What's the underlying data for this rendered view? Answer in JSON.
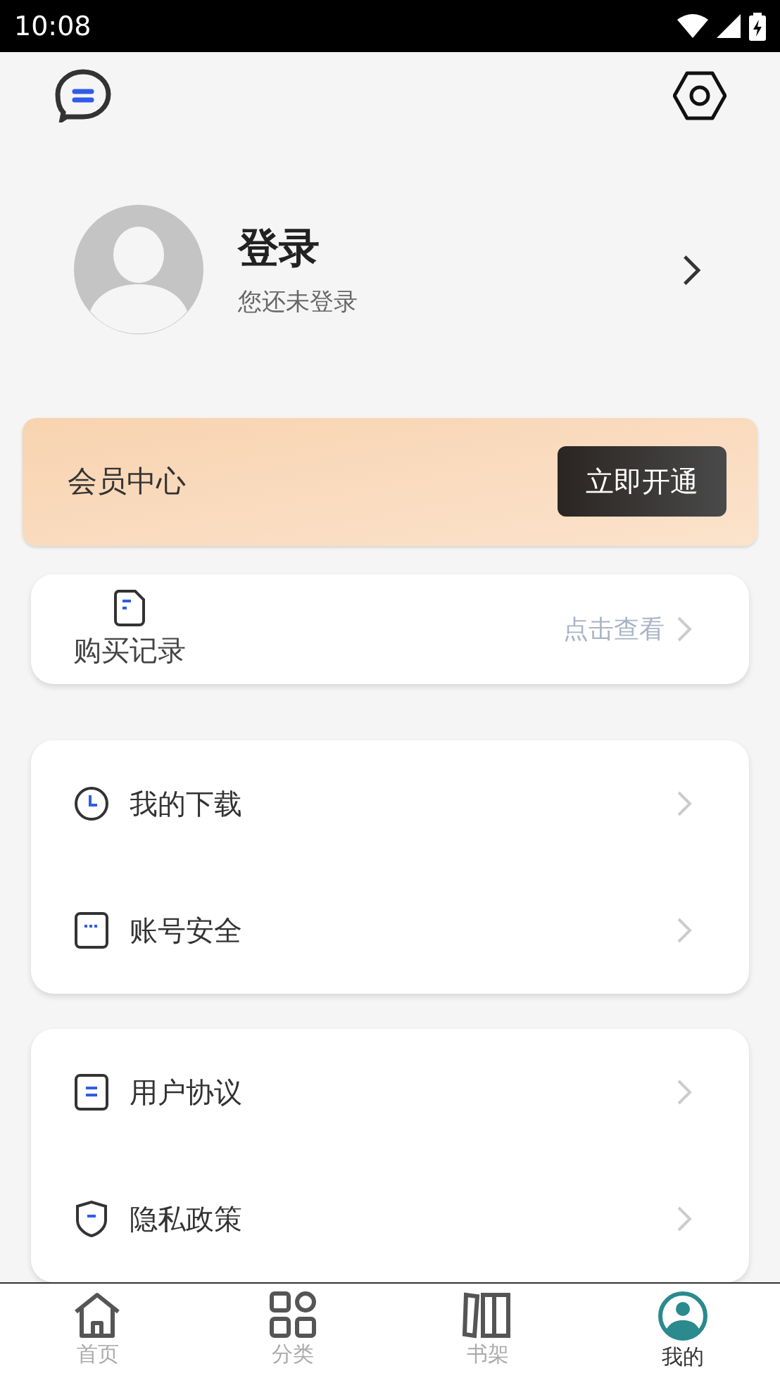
{
  "status_bar": {
    "time": "10:08"
  },
  "profile": {
    "title": "登录",
    "subtitle": "您还未登录"
  },
  "membership": {
    "title": "会员中心",
    "button": "立即开通"
  },
  "purchase": {
    "title": "购买记录",
    "action": "点击查看"
  },
  "menu_groups": [
    {
      "items": [
        {
          "kind": "clock",
          "label": "我的下载"
        },
        {
          "kind": "tablet",
          "label": "账号安全"
        }
      ]
    },
    {
      "items": [
        {
          "kind": "document",
          "label": "用户协议"
        },
        {
          "kind": "shield",
          "label": "隐私政策"
        }
      ]
    }
  ],
  "tabs": [
    {
      "kind": "home",
      "label": "首页",
      "selected": false
    },
    {
      "kind": "grid",
      "label": "分类",
      "selected": false
    },
    {
      "kind": "shelf",
      "label": "书架",
      "selected": false
    },
    {
      "kind": "user",
      "label": "我的",
      "selected": true
    }
  ]
}
